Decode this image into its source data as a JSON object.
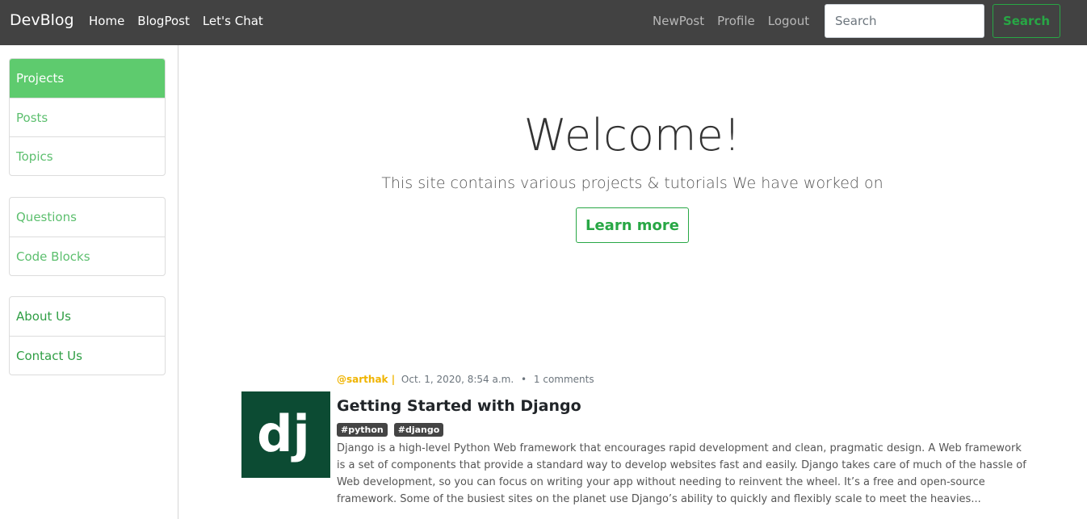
{
  "navbar": {
    "brand": "DevBlog",
    "left_links": [
      "Home",
      "BlogPost",
      "Let's Chat"
    ],
    "right_links": [
      "NewPost",
      "Profile",
      "Logout"
    ],
    "search_placeholder": "Search",
    "search_button": "Search"
  },
  "sidebar": {
    "group1": [
      "Projects",
      "Posts",
      "Topics"
    ],
    "group2": [
      "Questions",
      "Code Blocks"
    ],
    "group3": [
      "About Us",
      "Contact Us"
    ]
  },
  "hero": {
    "title": "Welcome!",
    "subtitle": "This site contains various projects & tutorials We have worked on",
    "button": "Learn more"
  },
  "post": {
    "author": "@sarthak |",
    "date": "Oct. 1, 2020, 8:54 a.m.",
    "separator": "•",
    "comments": "1 comments",
    "title": "Getting Started with Django",
    "tags": [
      "#python",
      "#django"
    ],
    "thumb_text": "dj",
    "excerpt": "Django is a high-level Python Web framework that encourages rapid development and clean, pragmatic design. A Web framework is a set of components that provide a standard way to develop websites fast and easily. Django takes care of much of the hassle of Web development, so you can focus on writing your app without needing to reinvent the wheel. It’s a free and open-source framework. Some of the busiest sites on the planet use Django’s ability to quickly and flexibly scale to meet the heavies..."
  },
  "colors": {
    "navbar_bg": "#424242",
    "accent_green": "#28a745",
    "sidebar_active": "#5ecb6e",
    "thumb_bg": "#0c4b33",
    "author_color": "#f0b400"
  }
}
